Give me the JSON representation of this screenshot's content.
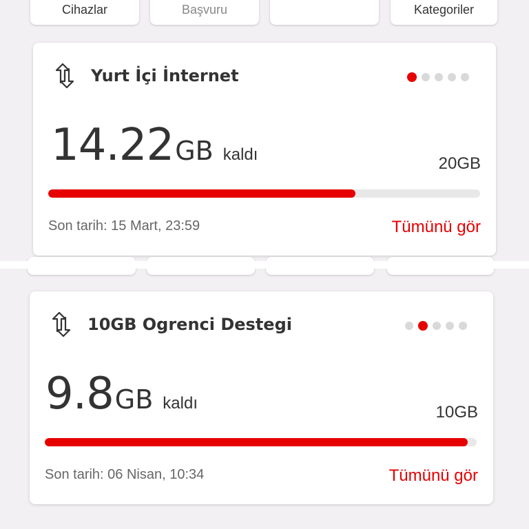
{
  "top_tiles": [
    "Cihazlar",
    "Başvuru",
    "",
    "Kategoriler"
  ],
  "cards": [
    {
      "title": "Yurt İçi İnternet",
      "remaining_value": "14.22",
      "remaining_unit": "GB",
      "remaining_suffix": "kaldı",
      "total": "20GB",
      "usage_fraction": 0.711,
      "due_date": "Son tarih: 15 Mart, 23:59",
      "see_all": "Tümünü gör",
      "pager": {
        "count": 5,
        "active": 0
      }
    },
    {
      "title": "10GB Ogrenci Destegi",
      "remaining_value": "9.8",
      "remaining_unit": "GB",
      "remaining_suffix": "kaldı",
      "total": "10GB",
      "usage_fraction": 0.98,
      "due_date": "Son tarih: 06 Nisan, 10:34",
      "see_all": "Tümünü gör",
      "pager": {
        "count": 5,
        "active": 1
      }
    }
  ],
  "icons": {
    "card_icon": "data-transfer-arrows-icon"
  },
  "colors": {
    "accent": "#e60000",
    "track": "#e8e8e8",
    "background": "#f2f0f2"
  }
}
